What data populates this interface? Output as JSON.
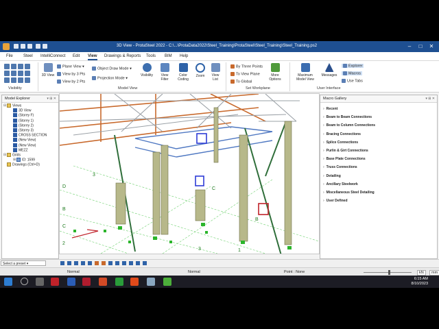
{
  "window": {
    "title": "3D View - ProtaSteel 2022 - C:\\...\\ProtaData2022\\Steel_Training\\ProtaSteel\\Steel_Training\\Steel_Training.ps2"
  },
  "menu": [
    "File",
    "Steel",
    "IntelliConnect",
    "Edit",
    "View",
    "Drawings & Reports",
    "Tools",
    "BIM",
    "Help"
  ],
  "menu_active": "View",
  "ribbon": {
    "visibility_group_label": "Visibility",
    "model_view_group_label": "Model View",
    "set_workplane_group_label": "Set Workplane",
    "user_interface_group_label": "User Interface",
    "view3d": "3D View",
    "plane_view": "Plane View",
    "view_by_3pts": "View by 3 Pts",
    "view_by_2pts": "View by 2 Pts",
    "object_draw_mode": "Object Draw Mode",
    "projection_mode": "Projection Mode",
    "visibility": "Visibility",
    "view_filter": "View Filter",
    "color_coding": "Color Coding",
    "zoom": "Zoom",
    "view_list": "View List",
    "by_three_points": "By Three Points",
    "to_view_plane": "To View Plane",
    "to_global": "To Global",
    "more_options": "More Options",
    "maximum_model_view": "Maximum Model View",
    "messages": "Messages",
    "explorer": "Explorer",
    "macros": "Macros",
    "use_tabs": "Use Tabs"
  },
  "model_explorer": {
    "title": "Model Explorer",
    "views_label": "Views",
    "views": [
      "3D View",
      "(Storey F)",
      "(Storey 1)",
      "(Storey 2)",
      "(Storey 3)",
      "CROSS SECTION",
      "(New View)",
      "(New View)",
      "MEZZ"
    ],
    "grids_label": "Grids",
    "grid_item": "ID: 1599",
    "drawings_label": "Drawings (Ctrl+D)"
  },
  "macro_gallery": {
    "title": "Macro Gallery",
    "items": [
      "Recent",
      "Beam to Beam Connections",
      "Beam to Column Connections",
      "Bracing Connections",
      "Splice Connections",
      "Purlin & Girt Connections",
      "Base Plate Connections",
      "Truss Connections",
      "Detailing",
      "Ancillary Steelwork",
      "Miscellaneous Steel Detailing",
      "User Defined"
    ]
  },
  "viewport": {
    "grid_labels": [
      "D",
      "3",
      "C",
      "2",
      "B",
      "C",
      "B",
      "3",
      "1"
    ],
    "scale_label": "1",
    "angle_label": "1_9"
  },
  "bottom": {
    "select_preset": "Select a preset",
    "normal_left": "Normal",
    "normal_right": "Normal",
    "point": "Point : None",
    "unit_force": "kN",
    "unit_length": "mm"
  },
  "taskbar": {
    "time": "6:15 AM",
    "date": "8/10/2023"
  },
  "colors": {
    "titlebar": "#1e4f91",
    "steel_orange": "#c8692c",
    "steel_grey": "#9aa0a6",
    "column": "#b7b88a",
    "support": "#2bb52b"
  }
}
